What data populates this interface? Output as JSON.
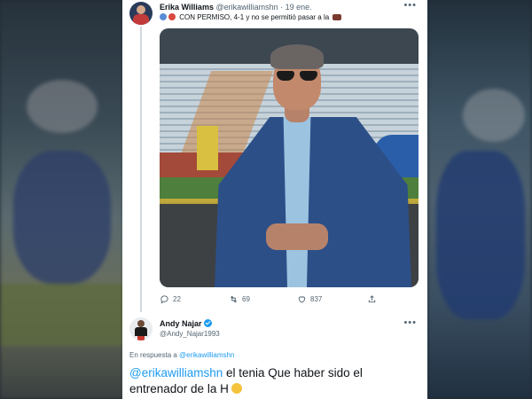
{
  "tweet": {
    "author": {
      "name": "Erika Williams",
      "handle": "@erikawilliamshn",
      "date": "· 19 ene."
    },
    "text": "CON PERMISO, 4-1 y no se permitió pasar a la",
    "photo": {
      "alt": "",
      "icon": "photo-man-stadium"
    },
    "metrics": {
      "replies": "22",
      "retweets": "69",
      "likes": "837"
    },
    "more_icon": "more-dots-icon"
  },
  "reply": {
    "author": {
      "name": "Andy Najar",
      "handle": "@Andy_Najar1993",
      "verified": true
    },
    "in_reply_prefix": "En respuesta a",
    "in_reply_handle": "@erikawilliamshn",
    "mention": "@erikawilliamshn",
    "text": " el tenia Que haber sido el entrenador de la H",
    "emoji": "shushing-face-emoji"
  },
  "colors": {
    "link": "#1d9bf0",
    "text": "#0f1419",
    "muted": "#536471",
    "card_bg": "#ffffff"
  }
}
